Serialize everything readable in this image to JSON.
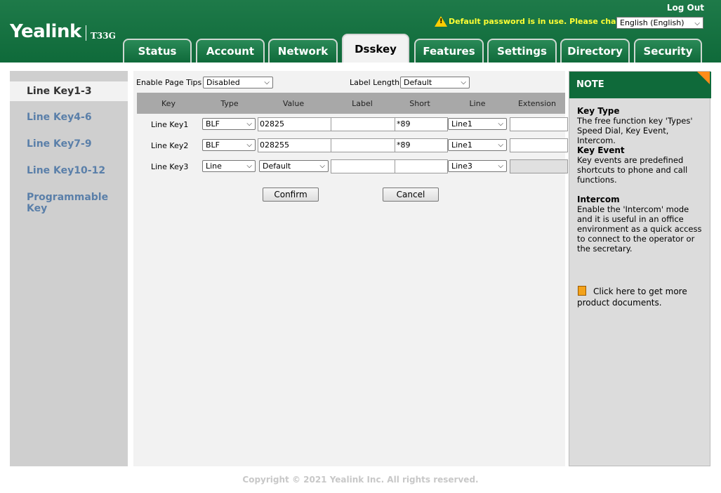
{
  "header": {
    "brand": "Yealink",
    "model": "T33G",
    "logout": "Log Out",
    "warning": "Default password is in use. Please change!",
    "language": "English (English)"
  },
  "tabs": [
    {
      "label": "Status"
    },
    {
      "label": "Account"
    },
    {
      "label": "Network"
    },
    {
      "label": "Dsskey",
      "active": true
    },
    {
      "label": "Features"
    },
    {
      "label": "Settings"
    },
    {
      "label": "Directory"
    },
    {
      "label": "Security"
    }
  ],
  "sidebar": {
    "items": [
      {
        "label": "Line Key1-3",
        "active": true
      },
      {
        "label": "Line Key4-6"
      },
      {
        "label": "Line Key7-9"
      },
      {
        "label": "Line Key10-12"
      },
      {
        "label": "Programmable Key"
      }
    ]
  },
  "main": {
    "page_tips_label": "Enable Page Tips",
    "page_tips_value": "Disabled",
    "label_length_label": "Label Length",
    "label_length_value": "Default",
    "columns": [
      "Key",
      "Type",
      "Value",
      "Label",
      "Short",
      "Line",
      "Extension"
    ],
    "rows": [
      {
        "key": "Line Key1",
        "type": "BLF",
        "value": "02825",
        "label": "",
        "short": "*89",
        "line": "Line1",
        "extension": ""
      },
      {
        "key": "Line Key2",
        "type": "BLF",
        "value": "028255",
        "label": "",
        "short": "*89",
        "line": "Line1",
        "extension": ""
      },
      {
        "key": "Line Key3",
        "type": "Line",
        "value": "Default",
        "label": "",
        "short": "",
        "line": "Line3",
        "extension": ""
      }
    ],
    "confirm": "Confirm",
    "cancel": "Cancel"
  },
  "note": {
    "title": "NOTE",
    "sections": [
      {
        "heading": "Key Type",
        "text": "The free function key 'Types' Speed Dial, Key Event, Intercom."
      },
      {
        "heading": "Key Event",
        "text": "Key events are predefined shortcuts to phone and call functions."
      },
      {
        "heading": "Intercom",
        "text": "Enable the 'Intercom' mode and it is useful in an office environment as a quick access to connect to the operator or the secretary."
      }
    ],
    "docs_link": "Click here to get more product documents."
  },
  "footer": "Copyright © 2021 Yealink Inc. All rights reserved.",
  "colors": {
    "brand_green": "#0f6a3a",
    "warning_yellow": "#ffff33",
    "nav_link": "#5a7fa9",
    "note_accent": "#ff8c1a"
  }
}
